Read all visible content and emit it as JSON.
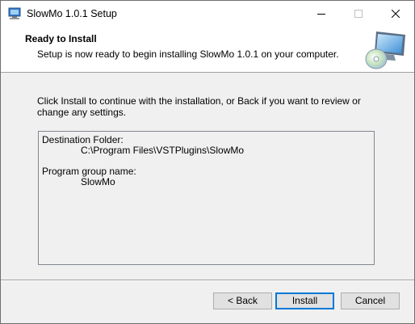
{
  "window": {
    "title": "SlowMo 1.0.1 Setup",
    "icon": "installer-app-icon",
    "controls": {
      "minimize": "minimize-icon",
      "maximize": "maximize-icon",
      "close": "close-icon"
    }
  },
  "header": {
    "title": "Ready to Install",
    "subtitle": "Setup is now ready to begin installing SlowMo 1.0.1 on your computer.",
    "graphic": "computer-cd-graphic"
  },
  "body": {
    "intro": "Click Install to continue with the installation, or Back if you want to review or change any settings.",
    "memo": {
      "destination_label": "Destination Folder:",
      "destination_value": "C:\\Program Files\\VSTPlugins\\SlowMo",
      "group_label": "Program group name:",
      "group_value": "SlowMo"
    }
  },
  "buttons": {
    "back": "< Back",
    "install": "Install",
    "cancel": "Cancel"
  },
  "colors": {
    "default_button_border": "#0078d7",
    "dialog_background": "#f0f0f0"
  }
}
